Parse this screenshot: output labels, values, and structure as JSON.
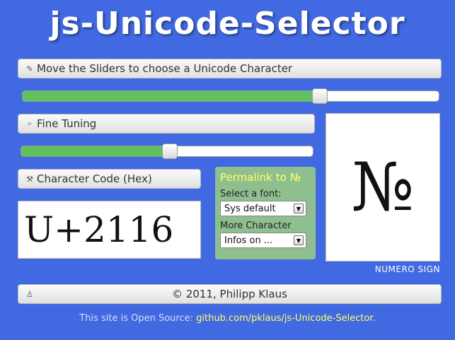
{
  "header": {
    "title": "js-Unicode-Selector"
  },
  "main_slider": {
    "label": "Move the Sliders to choose a Unicode Character",
    "icon": "pencil-icon",
    "value_percent": 71.5
  },
  "fine_tuning": {
    "label": "Fine Tuning",
    "icon": "search-icon",
    "value_percent": 51
  },
  "char_code": {
    "label": "Character Code (Hex)",
    "icon": "wrench-icon",
    "value": "U+2116"
  },
  "permalink": {
    "link_text": "Permalink to №",
    "font_label": "Select a font:",
    "font_selected": "Sys default",
    "more_label": "More Character",
    "more_selected": "Infos on ..."
  },
  "character": {
    "glyph": "№",
    "name": "NUMERO SIGN"
  },
  "copyright": {
    "text": "© 2011, Philipp Klaus",
    "icon": "person-icon"
  },
  "footer": {
    "prefix": "This site is Open Source: ",
    "link": "github.com/pklaus/js-Unicode-Selector",
    "suffix": "."
  },
  "colors": {
    "background": "#4169e1",
    "slider_fill": "#5fc25d",
    "permalink_bg": "#8fbf8e",
    "link": "#ffff66"
  }
}
